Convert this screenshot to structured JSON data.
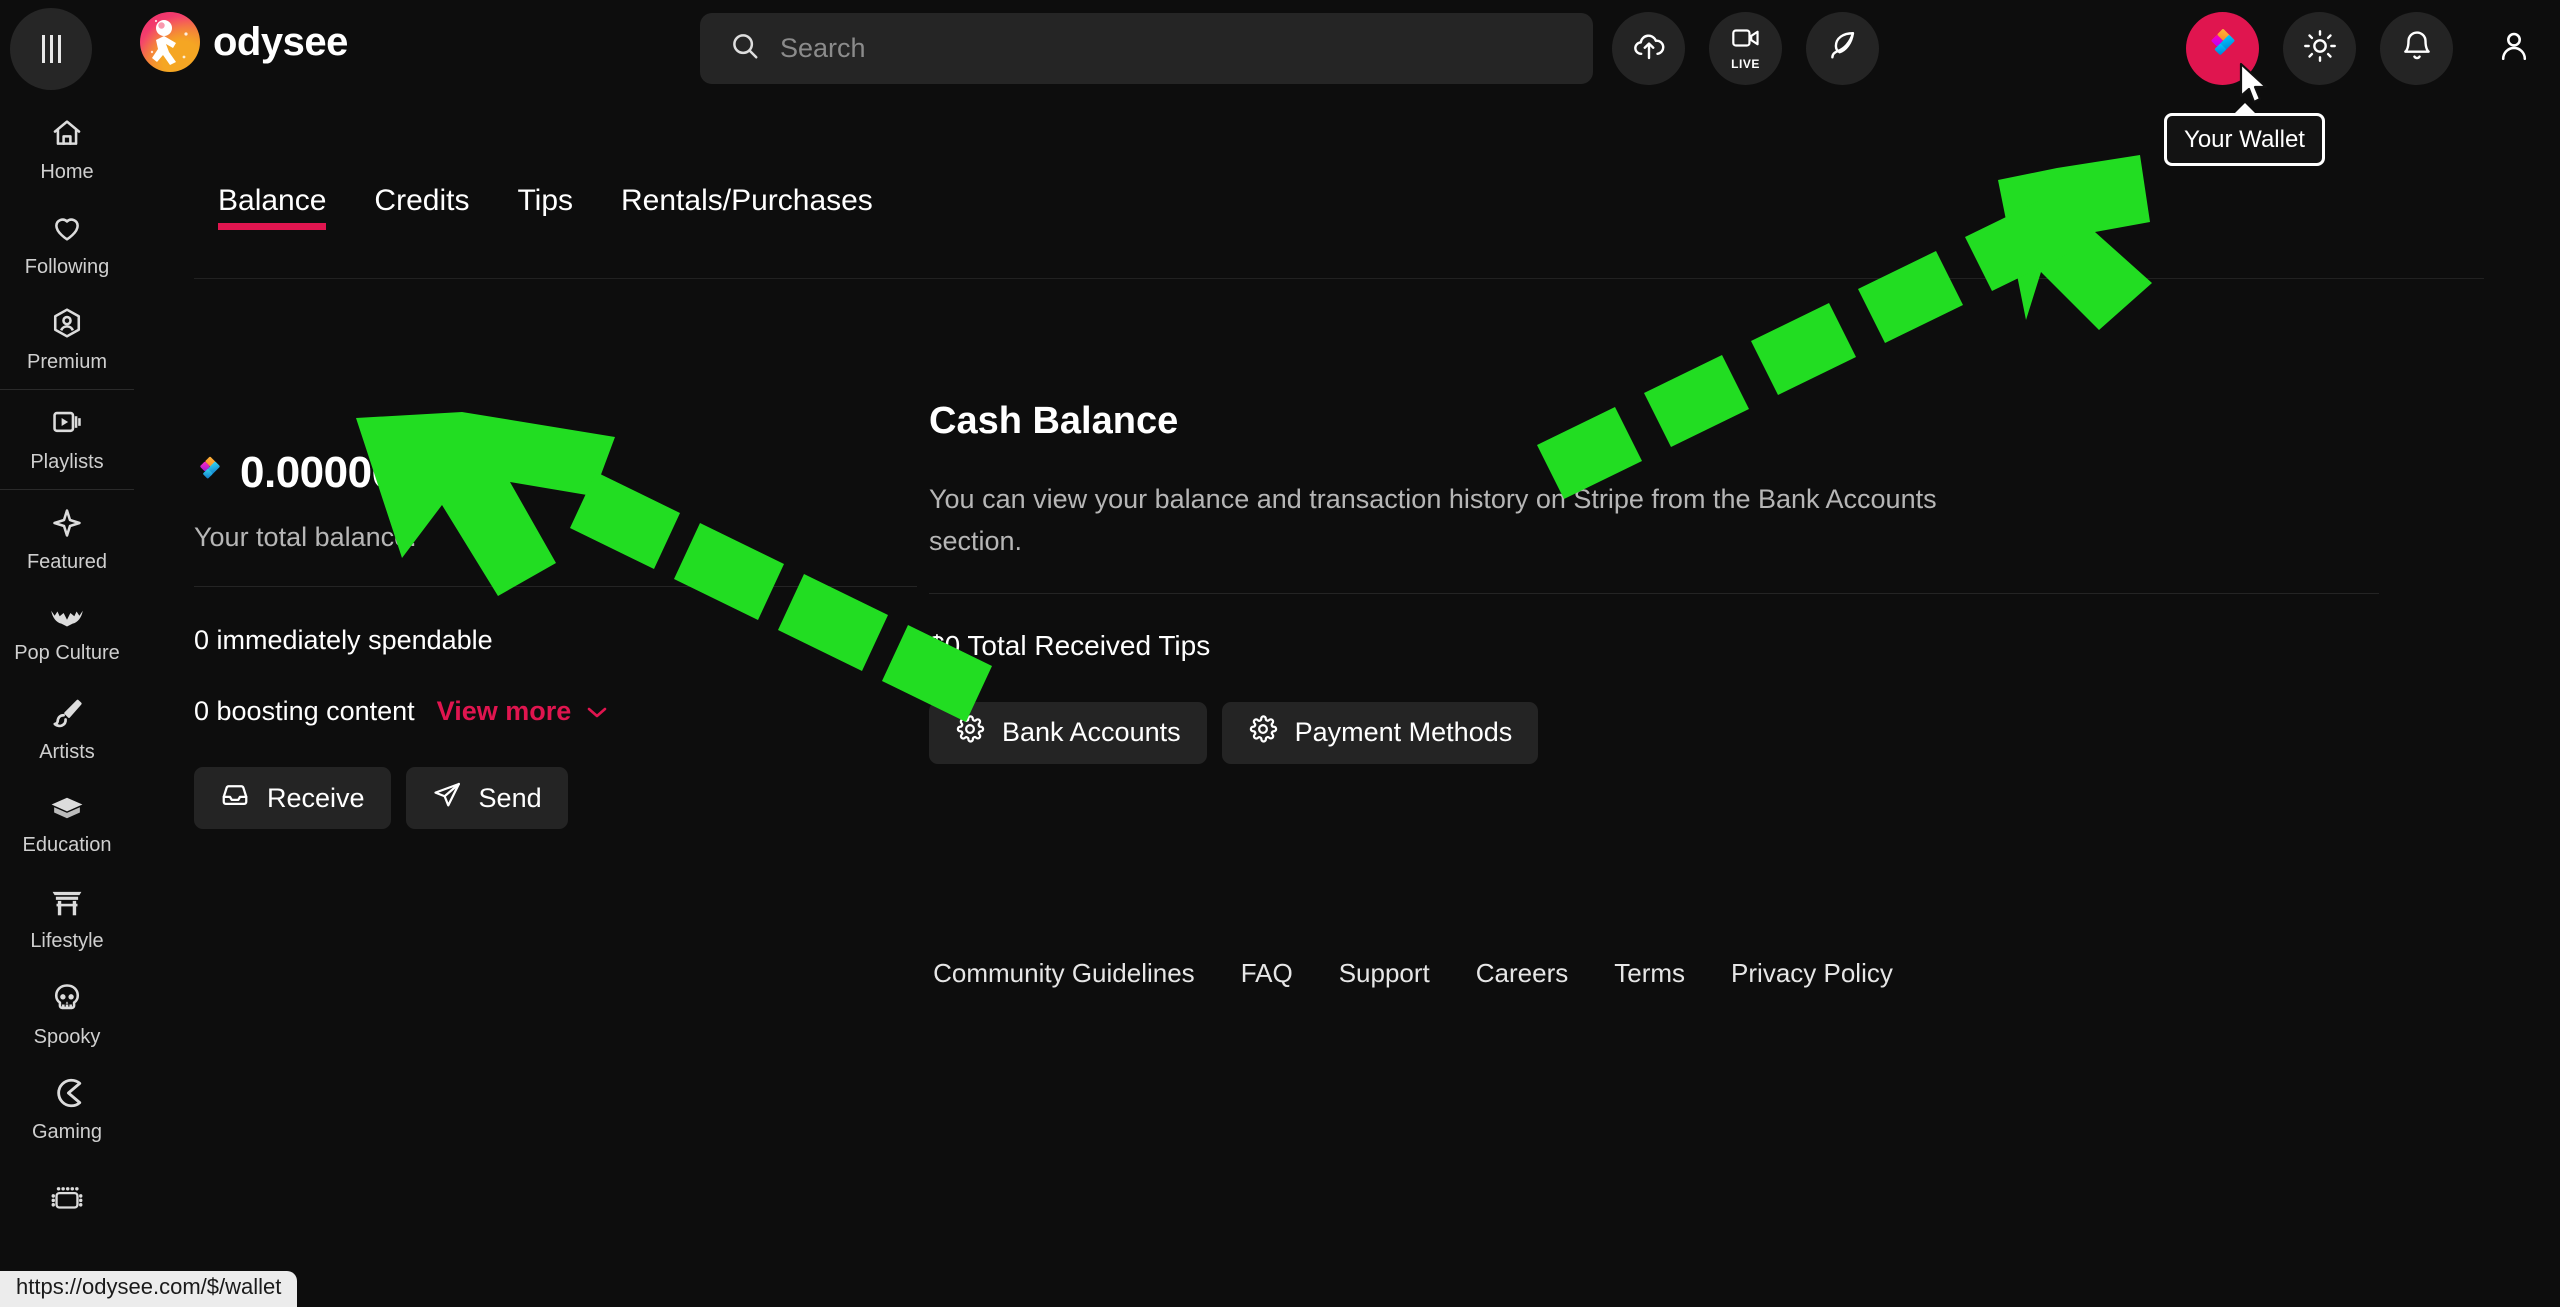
{
  "header": {
    "menu_icon": "hamburger-icon",
    "brand_name": "odysee",
    "search": {
      "placeholder": "Search",
      "icon": "search-icon"
    },
    "actions": [
      {
        "name": "upload-button",
        "icon": "cloud-upload-icon",
        "label": ""
      },
      {
        "name": "go-live-button",
        "icon": "video-camera-icon",
        "label": "LIVE"
      },
      {
        "name": "create-post-button",
        "icon": "quill-pen-icon",
        "label": ""
      },
      {
        "name": "wallet-button",
        "icon": "lbc-diamond-icon",
        "label": ""
      },
      {
        "name": "theme-toggle-button",
        "icon": "sun-icon",
        "label": ""
      },
      {
        "name": "notifications-button",
        "icon": "bell-icon",
        "label": ""
      },
      {
        "name": "account-button",
        "icon": "user-icon",
        "label": ""
      }
    ],
    "tooltip": "Your Wallet"
  },
  "sidebar": {
    "items": [
      {
        "label": "Home",
        "icon": "home-icon"
      },
      {
        "label": "Following",
        "icon": "heart-icon"
      },
      {
        "label": "Premium",
        "icon": "premium-badge-icon"
      },
      {
        "label": "Playlists",
        "icon": "playlist-icon"
      },
      {
        "label": "Featured",
        "icon": "sparkle-icon"
      },
      {
        "label": "Pop Culture",
        "icon": "bat-icon"
      },
      {
        "label": "Artists",
        "icon": "paintbrush-icon"
      },
      {
        "label": "Education",
        "icon": "graduation-cap-icon"
      },
      {
        "label": "Lifestyle",
        "icon": "torii-gate-icon"
      },
      {
        "label": "Spooky",
        "icon": "skull-icon"
      },
      {
        "label": "Gaming",
        "icon": "pacman-icon"
      },
      {
        "label": "",
        "icon": "film-strip-icon"
      }
    ]
  },
  "tabs": [
    {
      "label": "Balance",
      "active": true
    },
    {
      "label": "Credits",
      "active": false
    },
    {
      "label": "Tips",
      "active": false
    },
    {
      "label": "Rentals/Purchases",
      "active": false
    }
  ],
  "balance_panel": {
    "currency_icon": "lbc-icon",
    "amount": "0.00000000",
    "subtitle": "Your total balance.",
    "spendable": "0 immediately spendable",
    "boosting": "0 boosting content",
    "view_more": "View more",
    "view_more_icon": "chevron-down-icon",
    "receive_button": "Receive",
    "receive_icon": "inbox-icon",
    "send_button": "Send",
    "send_icon": "paper-plane-icon"
  },
  "cash_panel": {
    "title": "Cash Balance",
    "description": "You can view your balance and transaction history on Stripe from the Bank Accounts section.",
    "total_tips": "$0 Total Received Tips",
    "bank_accounts_button": "Bank Accounts",
    "bank_accounts_icon": "gear-icon",
    "payment_methods_button": "Payment Methods",
    "payment_methods_icon": "gear-icon"
  },
  "footer": {
    "links": [
      "Community Guidelines",
      "FAQ",
      "Support",
      "Careers",
      "Terms",
      "Privacy Policy"
    ]
  },
  "status_bar": {
    "url": "https://odysee.com/$/wallet"
  },
  "colors": {
    "background": "#0d0d0d",
    "surface": "#242424",
    "accent_pink": "#e0154f",
    "annotation_green": "#22dd22",
    "text_primary": "#ffffff",
    "text_secondary": "#b6b6b6"
  }
}
